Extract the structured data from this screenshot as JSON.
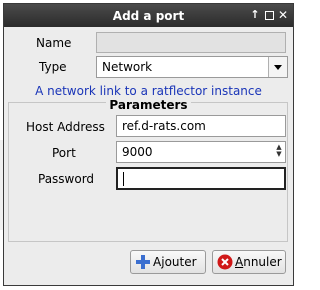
{
  "window": {
    "title": "Add a port"
  },
  "form": {
    "name_label": "Name",
    "name_value": "",
    "type_label": "Type",
    "type_value": "Network",
    "hint": "A network link to a ratflector instance"
  },
  "parameters": {
    "title": "Parameters",
    "host_label": "Host Address",
    "host_value": "ref.d-rats.com",
    "port_label": "Port",
    "port_value": "9000",
    "password_label": "Password",
    "password_value": ""
  },
  "buttons": {
    "add_prefix": "A",
    "add_mnemonic": "j",
    "add_suffix": "outer",
    "cancel_mnemonic": "A",
    "cancel_suffix": "nnuler"
  },
  "icons": {
    "title_buttons": [
      "pin-icon",
      "maximize-icon",
      "close-icon"
    ],
    "add": "plus-icon",
    "cancel": "cancel-icon"
  },
  "colors": {
    "hint": "#1a35b8",
    "titlebar": "#333333",
    "cancel_icon": "#d01818",
    "add_icon": "#3b6fd0"
  }
}
